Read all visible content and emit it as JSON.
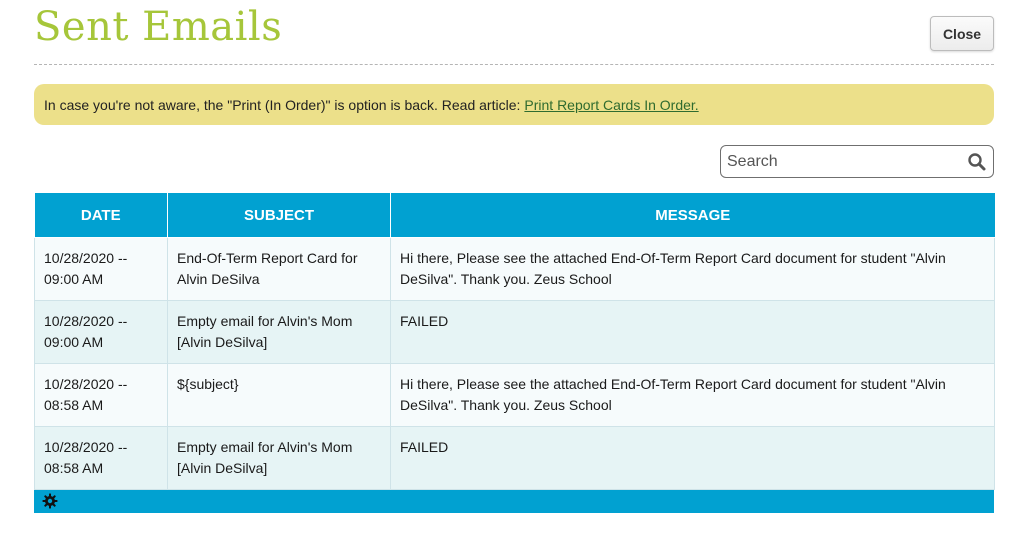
{
  "header": {
    "title": "Sent Emails",
    "close_label": "Close"
  },
  "notice": {
    "text": "In case you're not aware, the \"Print (In Order)\" is option is back. Read article:",
    "link_text": "Print Report Cards In Order."
  },
  "search": {
    "placeholder": "Search",
    "value": "",
    "icon": "search-icon"
  },
  "table": {
    "columns": [
      "DATE",
      "SUBJECT",
      "MESSAGE"
    ],
    "rows": [
      {
        "date": "10/28/2020 -- 09:00 AM",
        "subject": "End-Of-Term Report Card for Alvin DeSilva",
        "message": "Hi there, Please see the attached End-Of-Term Report Card document for student \"Alvin DeSilva\". Thank you. Zeus School"
      },
      {
        "date": "10/28/2020 -- 09:00 AM",
        "subject": "Empty email for Alvin's Mom [Alvin DeSilva]",
        "message": "FAILED"
      },
      {
        "date": "10/28/2020 -- 08:58 AM",
        "subject": "${subject}",
        "message": "Hi there, Please see the attached End-Of-Term Report Card document for student \"Alvin DeSilva\". Thank you. Zeus School"
      },
      {
        "date": "10/28/2020 -- 08:58 AM",
        "subject": "Empty email for Alvin's Mom [Alvin DeSilva]",
        "message": "FAILED"
      }
    ],
    "footer_icon": "gear-icon"
  },
  "colors": {
    "title": "#a6c63a",
    "notice_bg": "#ece08a",
    "table_header": "#01a1d1",
    "row_odd": "#f6fbfc",
    "row_even": "#e6f4f5"
  }
}
